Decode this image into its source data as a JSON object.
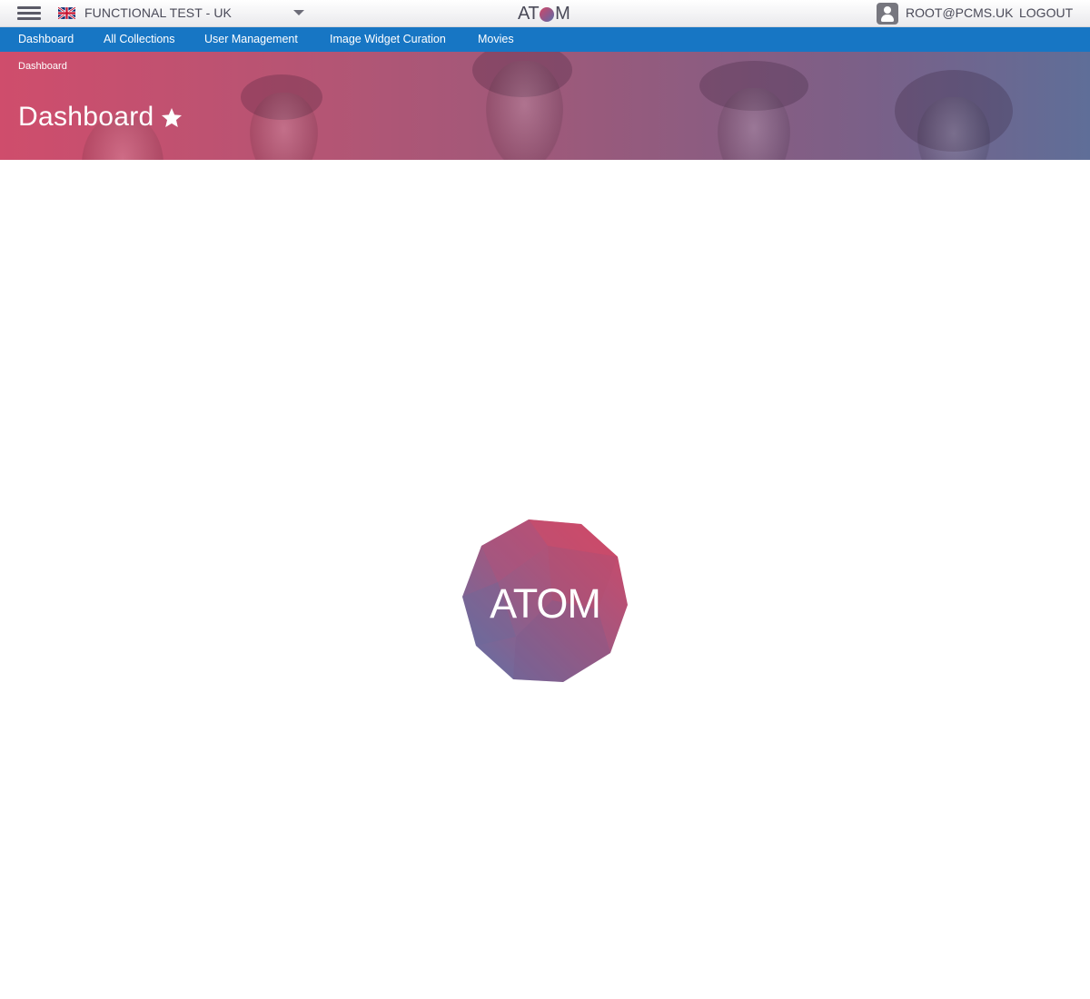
{
  "topbar": {
    "territory": "FUNCTIONAL TEST - UK",
    "brand": {
      "left": "AT",
      "right": "M"
    },
    "user_email": "ROOT@PCMS.UK",
    "logout_label": "LOGOUT"
  },
  "nav": {
    "items": [
      {
        "label": "Dashboard"
      },
      {
        "label": "All Collections"
      },
      {
        "label": "User Management"
      },
      {
        "label": "Image Widget Curation"
      },
      {
        "label": "Movies"
      }
    ]
  },
  "hero": {
    "breadcrumb": "Dashboard",
    "title": "Dashboard"
  },
  "loader": {
    "text": "ATOM"
  },
  "colors": {
    "nav_blue": "#1776c4",
    "brand_pink": "#d24766",
    "brand_blue": "#5b72a8"
  },
  "icons": [
    "hamburger-icon",
    "uk-flag-icon",
    "caret-down-icon",
    "user-icon",
    "star-icon",
    "atom-logo"
  ]
}
